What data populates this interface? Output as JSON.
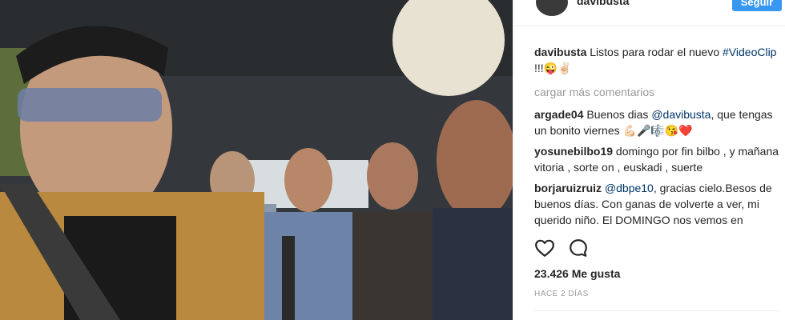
{
  "post": {
    "header": {
      "username": "davibusta",
      "follow_label": "Seguir"
    },
    "caption": {
      "username": "davibusta",
      "text": "Listos para rodar el nuevo",
      "hashtag": "#VideoClip",
      "suffix": "!!!😜✌🏻"
    },
    "load_more": "cargar más comentarios",
    "comments": [
      {
        "user": "argade04",
        "prefix": "Buenos dias ",
        "mention": "@davibusta",
        "suffix": ", que tengas un bonito viernes 💪🏻🎤🎼😘❤️"
      },
      {
        "user": "yosunebilbo19",
        "prefix": "domingo por fin bilbo , y mañana vitoria , sorte on , euskadi , suerte",
        "mention": "",
        "suffix": ""
      },
      {
        "user": "borjaruizruiz",
        "prefix": "",
        "mention": "@dbpe10",
        "suffix": ", gracias cielo.Besos de buenos días. Con ganas de volverte a ver, mi querido niño. El DOMINGO nos vemos en BILBAO en el EUSKALDUNA. ..."
      }
    ],
    "likes": "23.426 Me gusta",
    "time": "HACE 2 DÍAS",
    "icons": {
      "like": "heart-icon",
      "comment": "comment-bubble-icon"
    }
  },
  "colors": {
    "accent": "#3897f0",
    "link": "#003569",
    "muted": "#999999"
  }
}
